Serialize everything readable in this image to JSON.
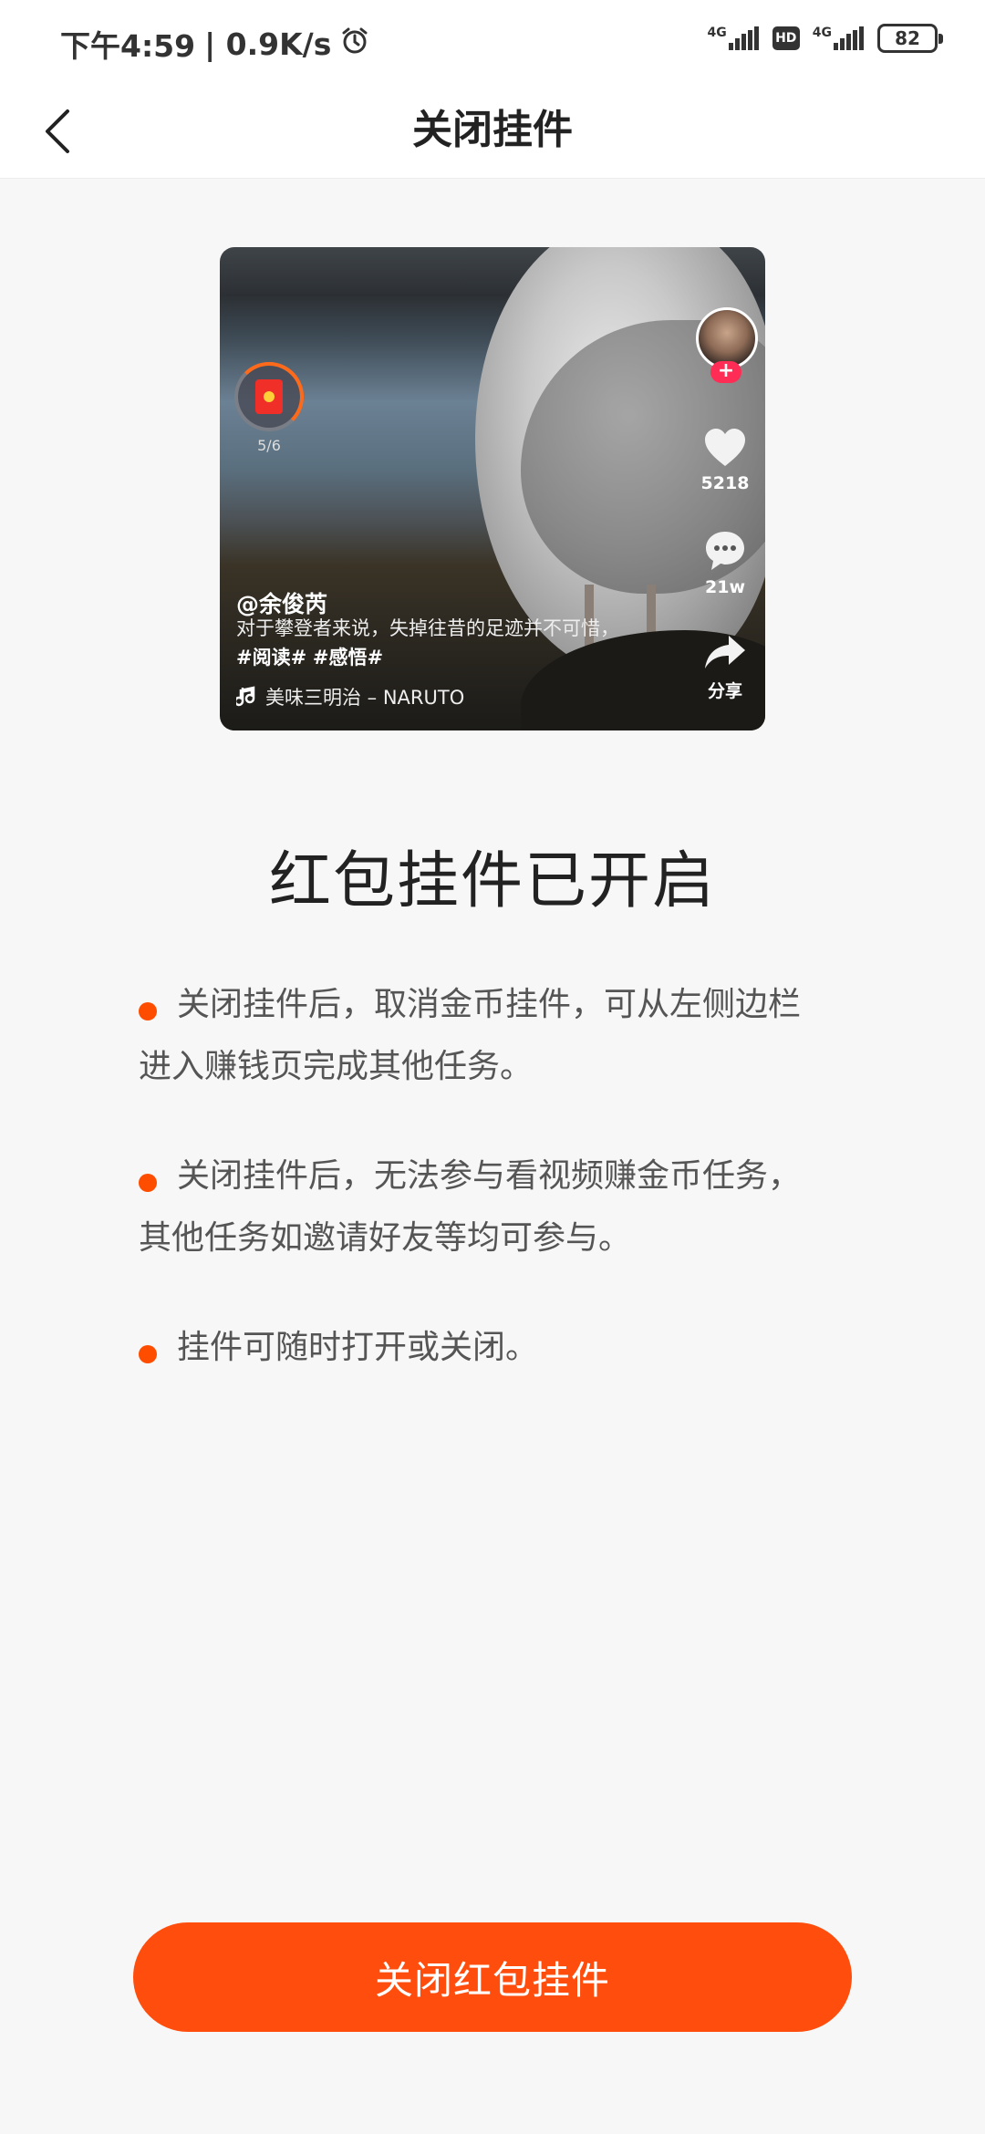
{
  "status_bar": {
    "time": "下午4:59",
    "speed": "| 0.9K/s",
    "network_1": "4G",
    "hd": "HD",
    "network_2": "4G",
    "battery": "82"
  },
  "header": {
    "title": "关闭挂件"
  },
  "preview": {
    "redpacket_progress": "5/6",
    "likes": "5218",
    "comments": "21w",
    "share": "分享",
    "author": "@余俊芮",
    "desc_text": "对于攀登者来说，失掉往昔的足迹并不可惜，",
    "tag_1": "#阅读#",
    "tag_2": "#感悟#",
    "music": "美味三明治 – NARUTO"
  },
  "main": {
    "heading": "红包挂件已开启",
    "bullets": [
      "关闭挂件后，取消金币挂件，可从左侧边栏进入赚钱页完成其他任务。",
      "关闭挂件后，无法参与看视频赚金币任务，其他任务如邀请好友等均可参与。",
      "挂件可随时打开或关闭。"
    ]
  },
  "footer": {
    "button_label": "关闭红包挂件"
  },
  "colors": {
    "accent": "#ff4d0d",
    "bullet_dot": "#ff4d00",
    "background": "#f7f7f7"
  }
}
